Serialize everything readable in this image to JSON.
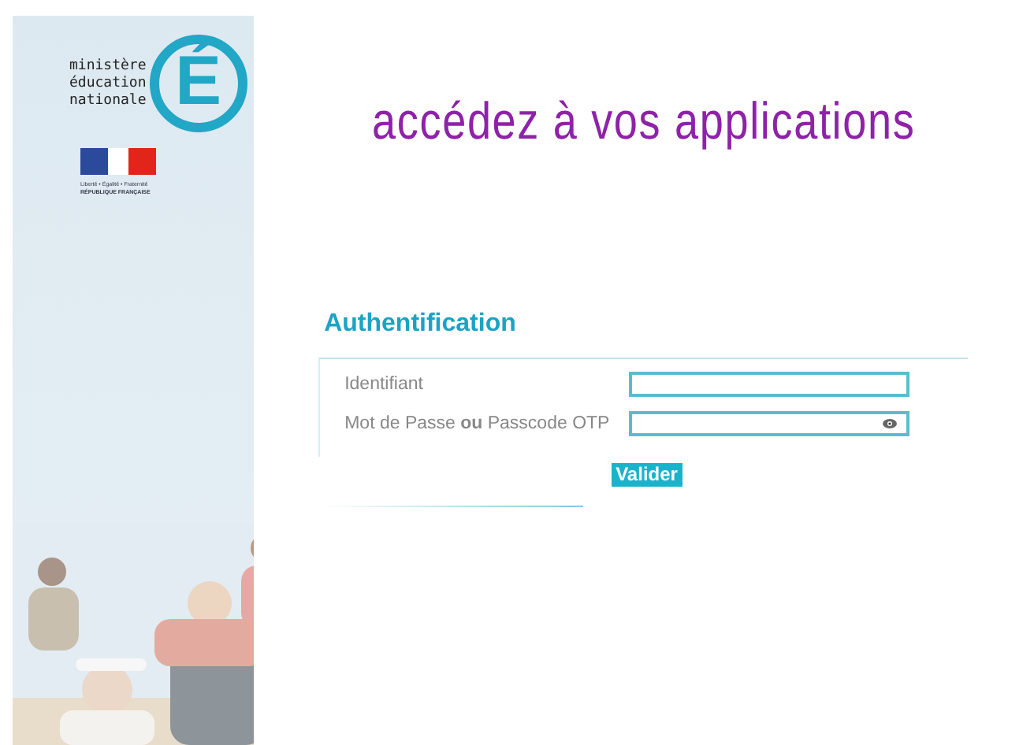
{
  "sidebar": {
    "logo": {
      "lines": [
        "ministère",
        "éducation",
        "nationale"
      ],
      "emblem": "É"
    },
    "republic": {
      "motto": "Liberté • Égalité • Fraternité",
      "name": "RÉPUBLIQUE FRANÇAISE"
    }
  },
  "headline": "accédez à vos applications",
  "form": {
    "title": "Authentification",
    "fields": [
      {
        "label": "Identifiant",
        "kind": "text"
      },
      {
        "label": "Mot de Passe **ou** Passcode OTP",
        "kind": "password"
      }
    ],
    "submit": "Valider"
  }
}
